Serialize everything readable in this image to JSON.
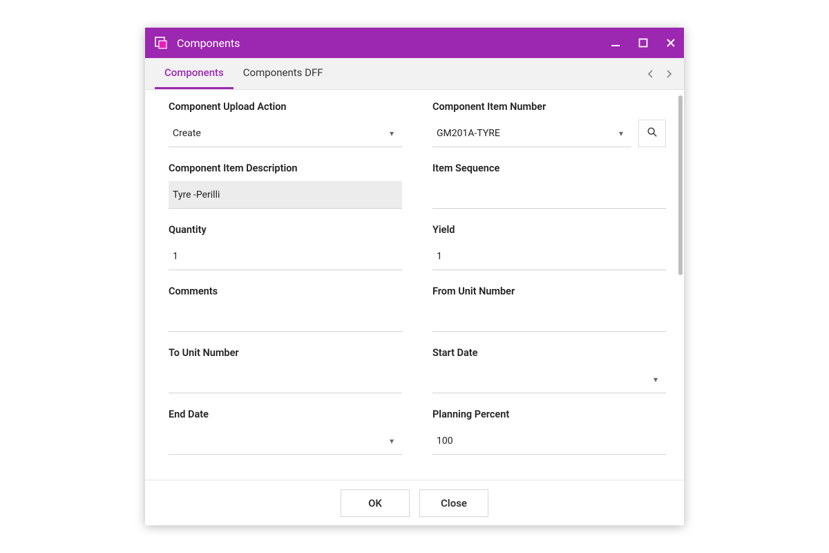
{
  "window": {
    "title": "Components"
  },
  "tabs": {
    "items": [
      {
        "label": "Components",
        "active": true
      },
      {
        "label": "Components DFF",
        "active": false
      }
    ]
  },
  "form": {
    "component_upload_action": {
      "label": "Component Upload Action",
      "value": "Create",
      "type": "select"
    },
    "component_item_number": {
      "label": "Component Item Number",
      "value": "GM201A-TYRE",
      "type": "select_search"
    },
    "component_item_description": {
      "label": "Component Item Description",
      "value": "Tyre -Perilli",
      "type": "readonly"
    },
    "item_sequence": {
      "label": "Item Sequence",
      "value": "",
      "type": "text"
    },
    "quantity": {
      "label": "Quantity",
      "value": "1",
      "type": "text"
    },
    "yield": {
      "label": "Yield",
      "value": "1",
      "type": "text"
    },
    "comments": {
      "label": "Comments",
      "value": "",
      "type": "text"
    },
    "from_unit_number": {
      "label": "From Unit Number",
      "value": "",
      "type": "text"
    },
    "to_unit_number": {
      "label": "To Unit Number",
      "value": "",
      "type": "text"
    },
    "start_date": {
      "label": "Start Date",
      "value": "",
      "type": "select"
    },
    "end_date": {
      "label": "End Date",
      "value": "",
      "type": "select"
    },
    "planning_percent": {
      "label": "Planning Percent",
      "value": "100",
      "type": "text"
    }
  },
  "footer": {
    "ok_label": "OK",
    "close_label": "Close"
  },
  "colors": {
    "accent": "#9c27b0"
  }
}
